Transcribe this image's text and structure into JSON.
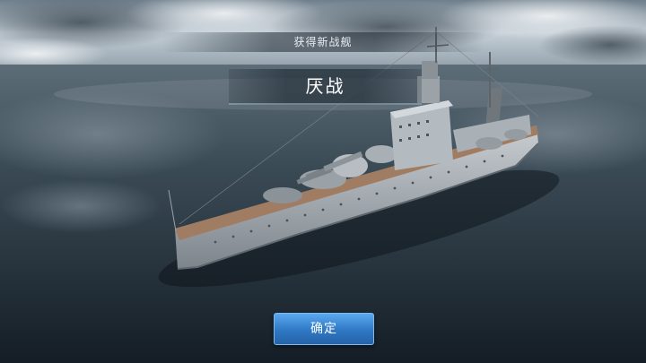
{
  "reward": {
    "header_label": "获得新战舰",
    "ship_name": "厌战",
    "confirm_label": "确定"
  },
  "colors": {
    "sky_top": "#8a9ba8",
    "sea": "#1f2d38",
    "button": "#3b87d4",
    "text": "#ffffff"
  }
}
